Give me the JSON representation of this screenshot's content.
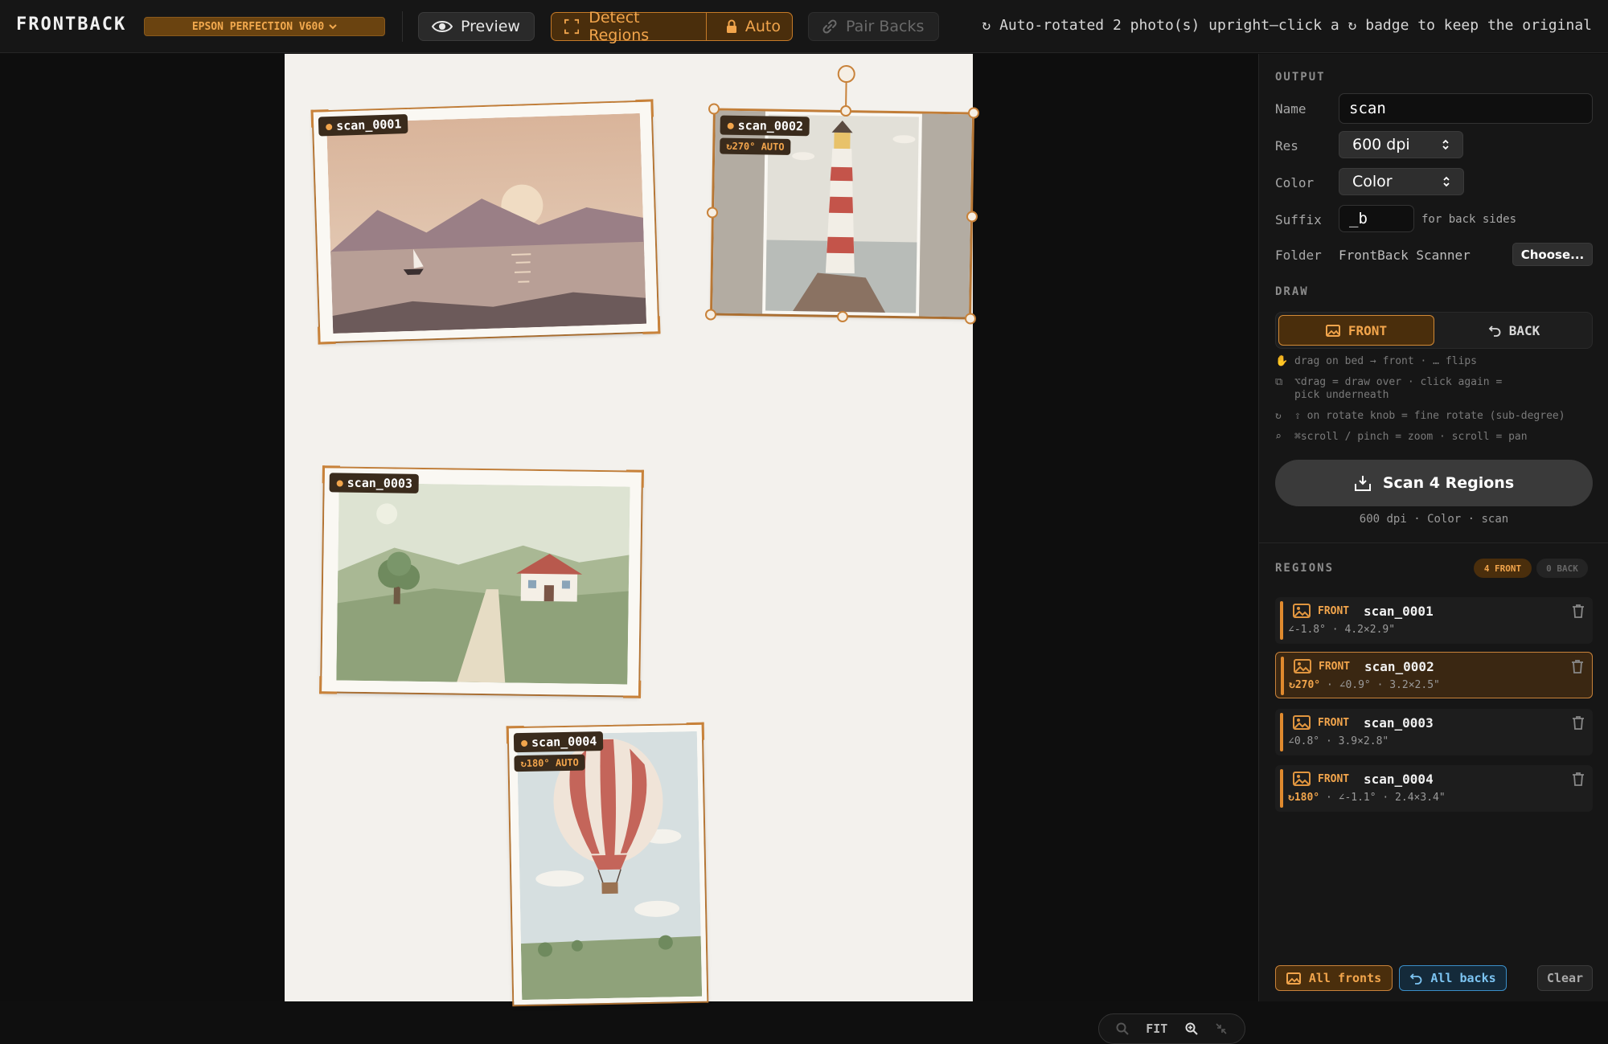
{
  "topbar": {
    "brand": "FRONTBACK",
    "scanner": "EPSON PERFECTION V600",
    "preview_label": "Preview",
    "detect_label": "Detect Regions",
    "auto_label": "Auto",
    "pair_label": "Pair Backs",
    "status": "↻ Auto-rotated 2 photo(s) upright—click a ↻ badge to keep the original"
  },
  "canvas": {
    "regions": [
      {
        "name": "scan_0001",
        "badge": ""
      },
      {
        "name": "scan_0002",
        "badge": "↻270° AUTO"
      },
      {
        "name": "scan_0003",
        "badge": ""
      },
      {
        "name": "scan_0004",
        "badge": "↻180° AUTO"
      }
    ],
    "zoom": {
      "fit_label": "FIT"
    }
  },
  "sidebar": {
    "output": {
      "title": "OUTPUT",
      "name_label": "Name",
      "name_value": "scan",
      "res_label": "Res",
      "res_value": "600 dpi",
      "color_label": "Color",
      "color_value": "Color",
      "suffix_label": "Suffix",
      "suffix_value": "_b",
      "suffix_note": "for back sides",
      "folder_label": "Folder",
      "folder_value": "FrontBack Scanner",
      "choose_label": "Choose..."
    },
    "draw": {
      "title": "DRAW",
      "front_label": "FRONT",
      "back_label": "BACK",
      "hints": [
        "drag on bed → front · … flips",
        "⌥drag = draw over · click again =",
        "pick underneath",
        "⇧ on rotate knob = fine rotate (sub-degree)",
        "⌘scroll / pinch = zoom · scroll = pan"
      ]
    },
    "scan": {
      "label": "Scan 4 Regions",
      "sub": "600 dpi · Color · scan"
    },
    "regions_panel": {
      "title": "REGIONS",
      "front_count": "4 FRONT",
      "back_count": "0 BACK",
      "items": [
        {
          "kind": "FRONT",
          "name": "scan_0001",
          "rot": "",
          "meta": "∠-1.8° · 4.2×2.9\""
        },
        {
          "kind": "FRONT",
          "name": "scan_0002",
          "rot": "↻270°",
          "meta": " · ∠0.9° · 3.2×2.5\""
        },
        {
          "kind": "FRONT",
          "name": "scan_0003",
          "rot": "",
          "meta": "∠0.8° · 3.9×2.8\""
        },
        {
          "kind": "FRONT",
          "name": "scan_0004",
          "rot": "↻180°",
          "meta": " · ∠-1.1° · 2.4×3.4\""
        }
      ]
    },
    "footer": {
      "all_fronts": "All fronts",
      "all_backs": "All backs",
      "clear": "Clear"
    }
  }
}
